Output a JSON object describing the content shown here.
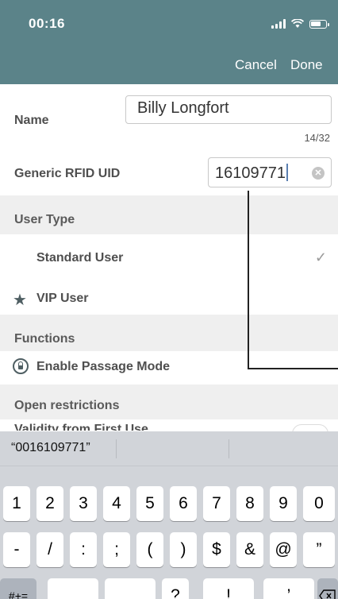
{
  "status": {
    "time": "00:16"
  },
  "nav": {
    "cancel": "Cancel",
    "done": "Done"
  },
  "form": {
    "name_label": "Name",
    "name_value": "Billy Longfort",
    "name_counter": "14/32",
    "rfid_label": "Generic RFID UID",
    "rfid_value": "16109771"
  },
  "user_type": {
    "title": "User Type",
    "standard": "Standard User",
    "vip": "VIP User",
    "selected": "Standard User"
  },
  "functions": {
    "title": "Functions",
    "passage_mode": "Enable Passage Mode"
  },
  "restrictions": {
    "title": "Open restrictions",
    "partial_row": "Validity from First Use"
  },
  "keyboard": {
    "suggestion": "“0016109771”",
    "row1": [
      "1",
      "2",
      "3",
      "4",
      "5",
      "6",
      "7",
      "8",
      "9",
      "0"
    ],
    "row2": [
      "-",
      "/",
      ":",
      ";",
      "(",
      ")",
      "$",
      "&",
      "@",
      "”"
    ],
    "row3": [
      "#+=",
      "?",
      "!",
      "’"
    ]
  },
  "colors": {
    "header": "#5b8389",
    "keyboard": "#d1d4d9",
    "section": "#efefef"
  }
}
